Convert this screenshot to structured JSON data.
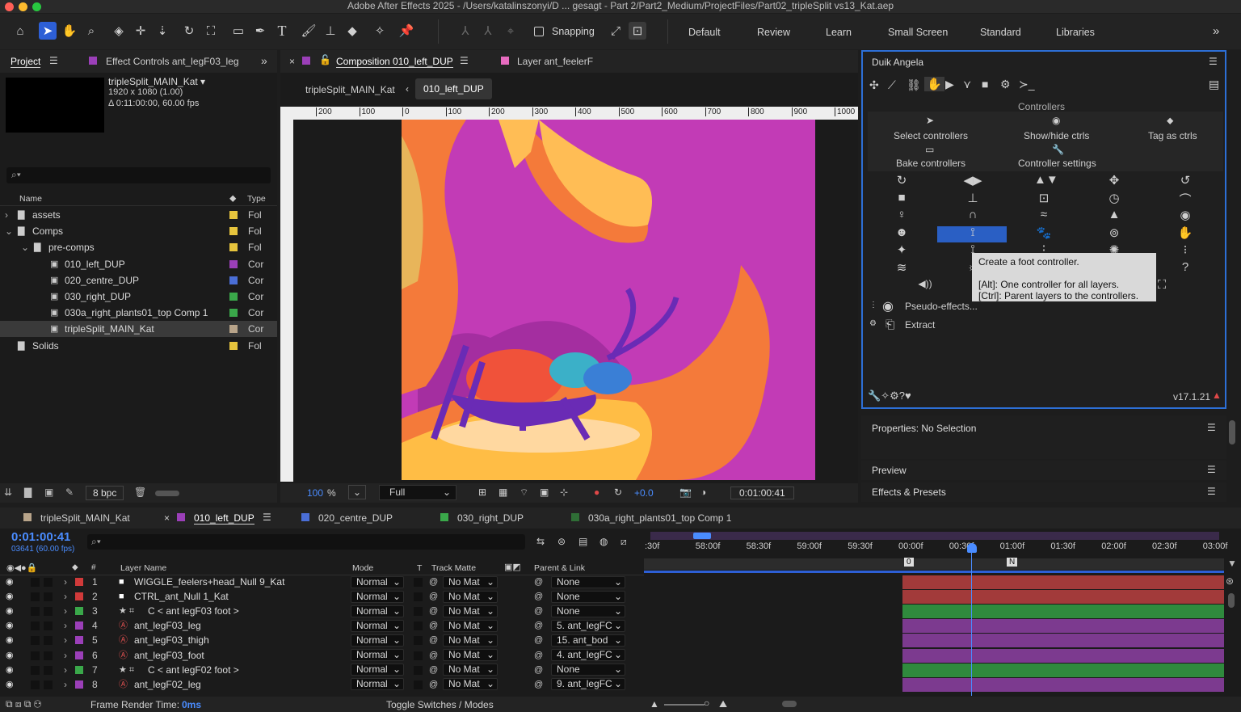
{
  "window": {
    "title": "Adobe After Effects 2025 - /Users/katalinszonyi/D ... gesagt - Part 2/Part2_Medium/ProjectFiles/Part02_tripleSplit vs13_Kat.aep"
  },
  "toolbar": {
    "snapping_label": "Snapping",
    "workspaces": [
      "Default",
      "Review",
      "Learn",
      "Small Screen",
      "Standard",
      "Libraries"
    ],
    "more": "»"
  },
  "project": {
    "tab": "Project",
    "effect_controls_tab": "Effect Controls ant_legF03_leg",
    "comp_name": "tripleSplit_MAIN_Kat ▾",
    "comp_size": "1920 x 1080 (1.00)",
    "comp_duration": "Δ 0:11:00:00, 60.00 fps",
    "col_name": "Name",
    "col_type": "Type",
    "items": [
      {
        "name": "assets",
        "type": "Fol",
        "color": "#e6c43d"
      },
      {
        "name": "Comps",
        "type": "Fol",
        "color": "#e6c43d"
      },
      {
        "name": "pre-comps",
        "type": "Fol",
        "color": "#e6c43d"
      },
      {
        "name": "010_left_DUP",
        "type": "Cor",
        "color": "#9b3fb8"
      },
      {
        "name": "020_centre_DUP",
        "type": "Cor",
        "color": "#4a6ed6"
      },
      {
        "name": "030_right_DUP",
        "type": "Cor",
        "color": "#3aa84a"
      },
      {
        "name": "030a_right_plants01_top Comp 1",
        "type": "Cor",
        "color": "#3aa84a"
      },
      {
        "name": "tripleSplit_MAIN_Kat",
        "type": "Cor",
        "color": "#b8a48a"
      },
      {
        "name": "Solids",
        "type": "Fol",
        "color": "#e6c43d"
      }
    ],
    "bpc": "8 bpc"
  },
  "composition": {
    "tab": "Composition 010_left_DUP",
    "layer_tab": "Layer ant_feelerF",
    "crumb1": "tripleSplit_MAIN_Kat",
    "crumb2": "010_left_DUP",
    "ruler": [
      "200",
      "100",
      "0",
      "100",
      "200",
      "300",
      "400",
      "500",
      "600",
      "700",
      "800",
      "900",
      "1000"
    ],
    "zoom": "100",
    "zoom_unit": "%",
    "resolution": "Full",
    "exposure": "+0.0",
    "timecode": "0:01:00:41"
  },
  "duik": {
    "title": "Duik Angela",
    "section": "Controllers",
    "select": "Select controllers",
    "show_hide": "Show/hide ctrls",
    "tag": "Tag as ctrls",
    "bake": "Bake controllers",
    "settings": "Controller settings",
    "tooltip_title": "Create a foot controller.",
    "tooltip_alt": "[Alt]: One controller for all layers.",
    "tooltip_ctrl": "[Ctrl]: Parent layers to the controllers.",
    "pseudo": "Pseudo-effects...",
    "extract": "Extract",
    "version": "v17.1.21"
  },
  "properties": {
    "title": "Properties: No Selection"
  },
  "preview": {
    "title": "Preview"
  },
  "effects": {
    "title": "Effects & Presets"
  },
  "timeline": {
    "tabs": [
      "tripleSplit_MAIN_Kat",
      "010_left_DUP",
      "020_centre_DUP",
      "030_right_DUP",
      "030a_right_plants01_top Comp 1"
    ],
    "tab_colors": [
      "#b8a48a",
      "#9b3fb8",
      "#4a6ed6",
      "#3aa84a",
      "#2f6e36"
    ],
    "timecode": "0:01:00:41",
    "frames": "03641 (60.00 fps)",
    "col_layer": "Layer Name",
    "col_mode": "Mode",
    "col_t": "T",
    "col_matte": "Track Matte",
    "col_parent": "Parent & Link",
    "ticks": [
      ":30f",
      "58:00f",
      "58:30f",
      "59:00f",
      "59:30f",
      "00:00f",
      "00:30f",
      "01:00f",
      "01:30f",
      "02:00f",
      "02:30f",
      "03:00f"
    ],
    "markers": [
      "0",
      "N"
    ],
    "layers": [
      {
        "num": "1",
        "name": "WIGGLE_feelers+head_Null 9_Kat",
        "mode": "Normal",
        "matte": "No Mat",
        "parent": "None",
        "color": "#d03a3a",
        "bar": "#a23a3a"
      },
      {
        "num": "2",
        "name": "CTRL_ant_Null 1_Kat",
        "mode": "Normal",
        "matte": "No Mat",
        "parent": "None",
        "color": "#d03a3a",
        "bar": "#a23a3a"
      },
      {
        "num": "3",
        "name": "C < ant legF03 foot >",
        "mode": "Normal",
        "matte": "No Mat",
        "parent": "None",
        "color": "#3aa84a",
        "bar": "#2f8a3d"
      },
      {
        "num": "4",
        "name": "ant_legF03_leg",
        "mode": "Normal",
        "matte": "No Mat",
        "parent": "5. ant_legFC",
        "color": "#9b3fb8",
        "bar": "#7c3a8f"
      },
      {
        "num": "5",
        "name": "ant_legF03_thigh",
        "mode": "Normal",
        "matte": "No Mat",
        "parent": "15. ant_bod",
        "color": "#9b3fb8",
        "bar": "#7c3a8f"
      },
      {
        "num": "6",
        "name": "ant_legF03_foot",
        "mode": "Normal",
        "matte": "No Mat",
        "parent": "4. ant_legFC",
        "color": "#9b3fb8",
        "bar": "#7c3a8f"
      },
      {
        "num": "7",
        "name": "C < ant legF02 foot >",
        "mode": "Normal",
        "matte": "No Mat",
        "parent": "None",
        "color": "#3aa84a",
        "bar": "#2f8a3d"
      },
      {
        "num": "8",
        "name": "ant_legF02_leg",
        "mode": "Normal",
        "matte": "No Mat",
        "parent": "9. ant_legFC",
        "color": "#9b3fb8",
        "bar": "#7c3a8f"
      }
    ],
    "render_label": "Frame Render Time:",
    "render_value": "0ms",
    "toggle": "Toggle Switches / Modes"
  }
}
